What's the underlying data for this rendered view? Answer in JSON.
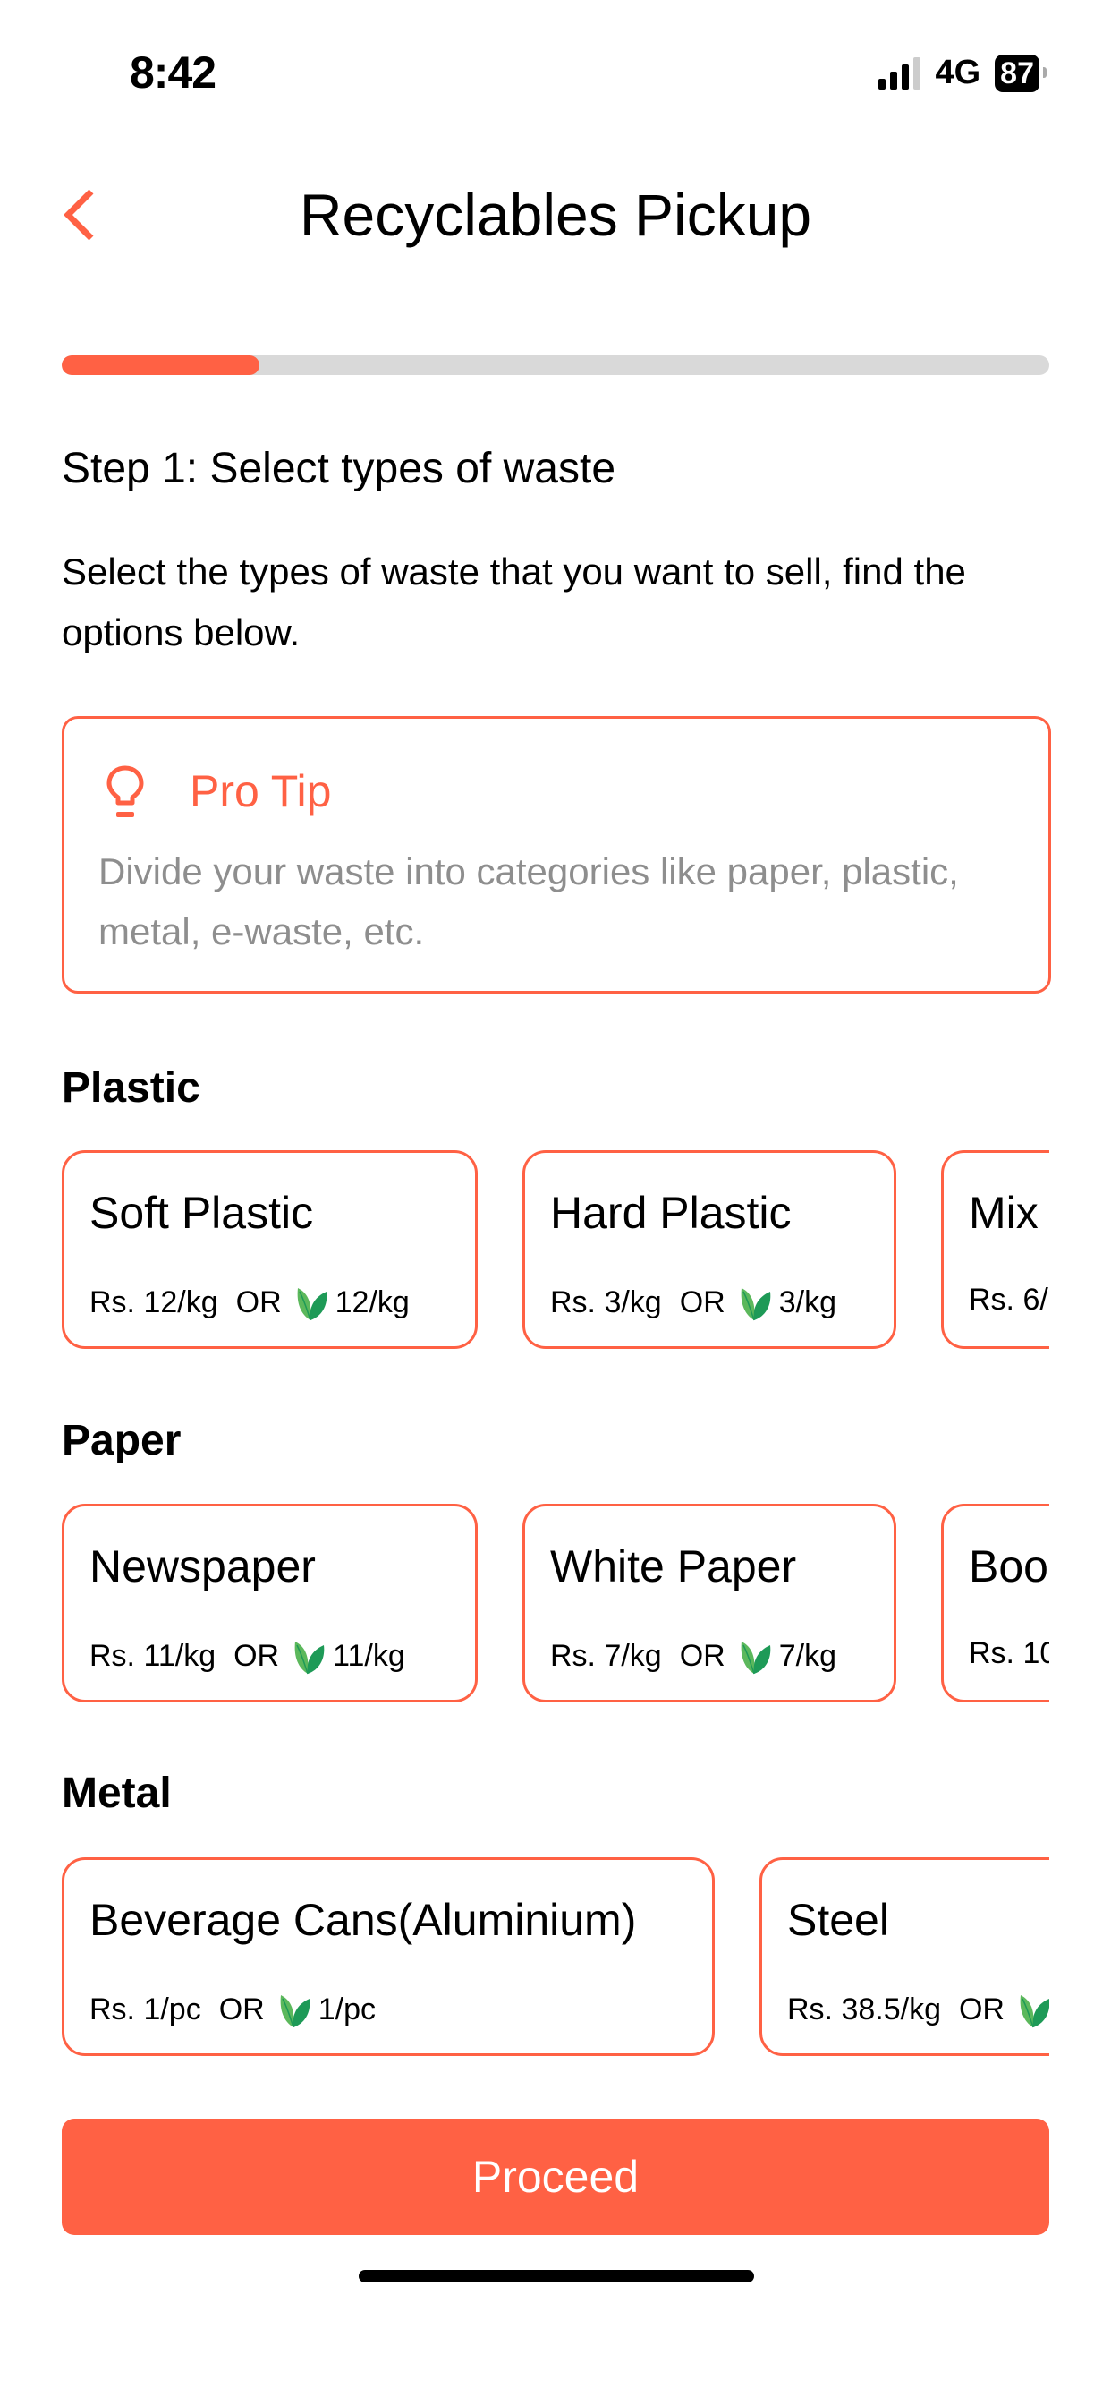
{
  "status_bar": {
    "time": "8:42",
    "network": "4G",
    "battery": "87"
  },
  "header": {
    "title": "Recyclables Pickup",
    "back_icon": "chevron-left-icon"
  },
  "progress": {
    "percent": 20
  },
  "step": {
    "title": "Step 1: Select types of waste",
    "description": "Select the types of waste that you want to sell, find the options below."
  },
  "pro_tip": {
    "icon": "lightbulb-icon",
    "title": "Pro Tip",
    "text": "Divide your waste into categories like paper, plastic, metal, e-waste, etc."
  },
  "or_label": "OR",
  "sections": [
    {
      "title": "Plastic",
      "items": [
        {
          "name": "Soft Plastic",
          "cash": "Rs. 12/kg",
          "points": "12/kg"
        },
        {
          "name": "Hard Plastic",
          "cash": "Rs. 3/kg",
          "points": "3/kg"
        },
        {
          "name": "Mix",
          "cash": "Rs. 6/",
          "points": ""
        }
      ]
    },
    {
      "title": "Paper",
      "items": [
        {
          "name": "Newspaper",
          "cash": "Rs. 11/kg",
          "points": "11/kg"
        },
        {
          "name": "White Paper",
          "cash": "Rs. 7/kg",
          "points": "7/kg"
        },
        {
          "name": "Boo",
          "cash": "Rs. 10",
          "points": ""
        }
      ]
    },
    {
      "title": "Metal",
      "items": [
        {
          "name": "Beverage Cans(Aluminium)",
          "cash": "Rs. 1/pc",
          "points": "1/pc"
        },
        {
          "name": "Steel",
          "cash": "Rs. 38.5/kg",
          "points": ""
        }
      ]
    }
  ],
  "proceed_label": "Proceed",
  "colors": {
    "accent": "#FF6144",
    "track": "#D9D9D9",
    "leaf_light": "#5CB85C",
    "leaf_dark": "#1E9A57",
    "muted_text": "#8E8E8E"
  }
}
